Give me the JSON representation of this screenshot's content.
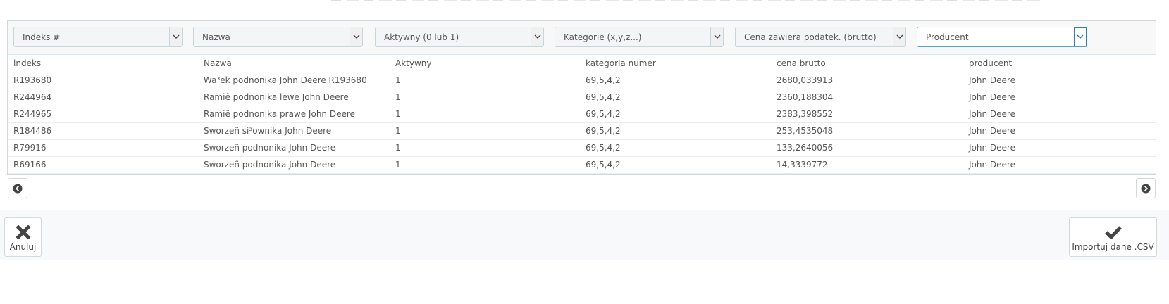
{
  "columns": {
    "selects": [
      {
        "label": "Indeks #"
      },
      {
        "label": "Nazwa"
      },
      {
        "label": "Aktywny (0 lub 1)"
      },
      {
        "label": "Kategorie (x,y,z...)"
      },
      {
        "label": "Cena zawiera podatek. (brutto)"
      },
      {
        "label": "Producent"
      }
    ]
  },
  "table": {
    "headers": [
      "indeks",
      "Nazwa",
      "Aktywny",
      "kategoria numer",
      "cena brutto",
      "producent"
    ],
    "rows": [
      [
        "R193680",
        "Wa³ek podnonika John Deere R193680",
        "1",
        "69,5,4,2",
        "2680,033913",
        "John Deere"
      ],
      [
        "R244964",
        "Ramiê podnonika lewe John Deere",
        "1",
        "69,5,4,2",
        "2360,188304",
        "John Deere"
      ],
      [
        "R244965",
        "Ramiê podnonika prawe John Deere",
        "1",
        "69,5,4,2",
        "2383,398552",
        "John Deere"
      ],
      [
        "R184486",
        "Sworzeñ si³ownika John Deere",
        "1",
        "69,5,4,2",
        "253,4535048",
        "John Deere"
      ],
      [
        "R79916",
        "Sworzeñ podnonika John Deere",
        "1",
        "69,5,4,2",
        "133,2640056",
        "John Deere"
      ],
      [
        "R69166",
        "Sworzeñ podnonika John Deere",
        "1",
        "69,5,4,2",
        "14,3339772",
        "John Deere"
      ]
    ]
  },
  "footer": {
    "cancel_label": "Anuluj",
    "import_label": "Importuj dane .CSV"
  },
  "icons": {
    "pager_prev": "chevron-left-circle-icon",
    "pager_next": "chevron-right-circle-icon",
    "cancel": "close-icon",
    "import": "check-icon",
    "select_arrow": "chevron-down-icon"
  },
  "colors": {
    "active_select_border": "#4ea3d8",
    "icon_dark": "#444444"
  }
}
